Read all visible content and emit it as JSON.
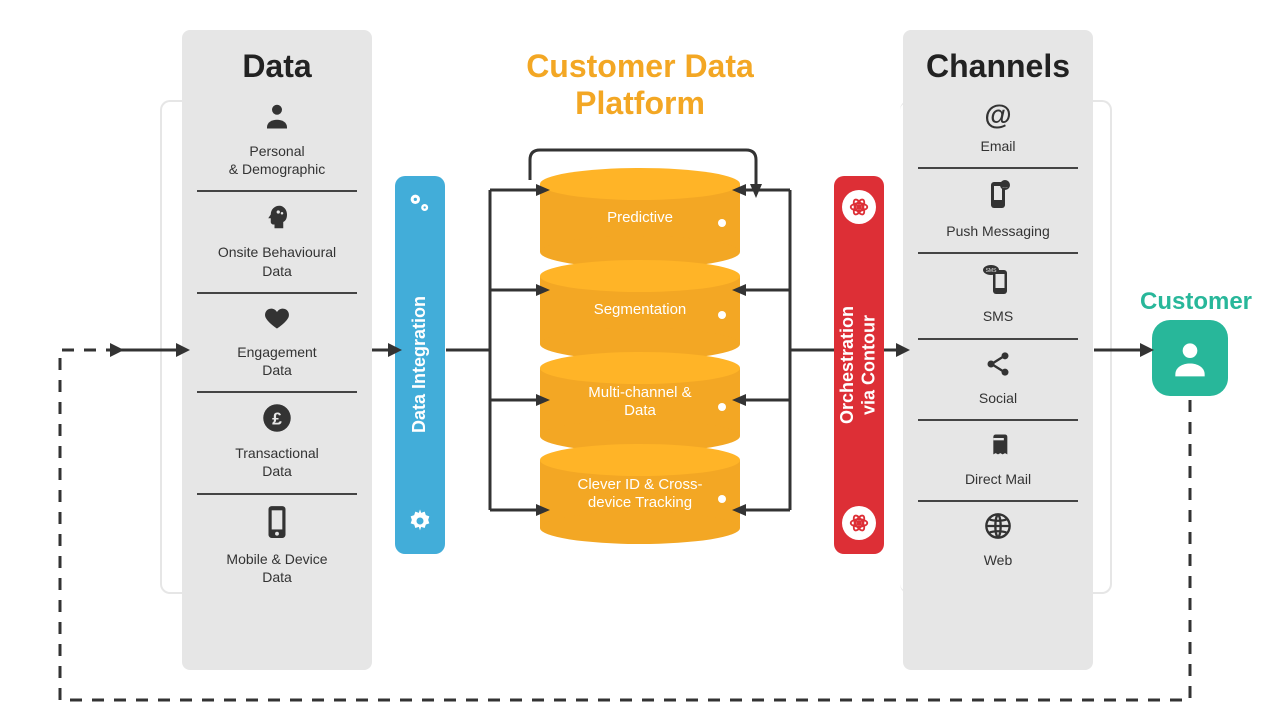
{
  "data_panel": {
    "title": "Data",
    "items": [
      {
        "label": "Personal\n& Demographic",
        "icon": "user"
      },
      {
        "label": "Onsite Behavioural\nData",
        "icon": "head-gear"
      },
      {
        "label": "Engagement\nData",
        "icon": "heart"
      },
      {
        "label": "Transactional\nData",
        "icon": "pound"
      },
      {
        "label": "Mobile & Device\nData",
        "icon": "mobile"
      }
    ]
  },
  "integration_pillar": {
    "label": "Data Integration"
  },
  "cdp": {
    "title": "Customer Data\nPlatform",
    "layers": [
      "Predictive",
      "Segmentation",
      "Multi-channel &\nData",
      "Clever ID & Cross-\ndevice Tracking"
    ]
  },
  "orchestration_pillar": {
    "label": "Orchestration\nvia Contour"
  },
  "channels_panel": {
    "title": "Channels",
    "items": [
      {
        "label": "Email",
        "icon": "at"
      },
      {
        "label": "Push Messaging",
        "icon": "push"
      },
      {
        "label": "SMS",
        "icon": "sms"
      },
      {
        "label": "Social",
        "icon": "share"
      },
      {
        "label": "Direct Mail",
        "icon": "book"
      },
      {
        "label": "Web",
        "icon": "globe"
      }
    ]
  },
  "customer": {
    "title": "Customer"
  },
  "colors": {
    "panel_bg": "#e6e6e6",
    "blue": "#42add9",
    "red": "#dd2f36",
    "orange": "#f3a724",
    "teal": "#28b79a",
    "ink": "#333333"
  }
}
